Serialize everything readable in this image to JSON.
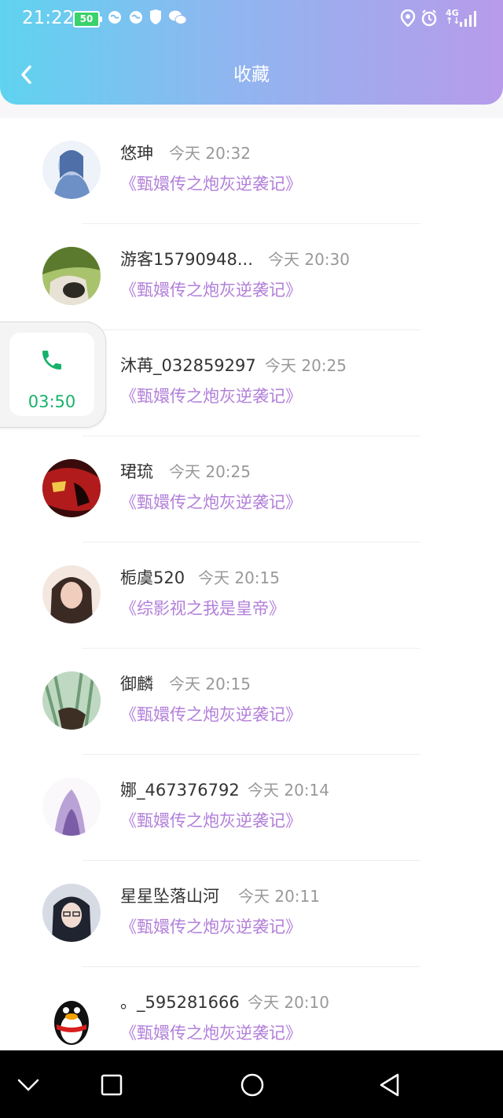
{
  "status_bar": {
    "time": "21:22",
    "battery": "50",
    "network": "4G",
    "network_sub": "↑↓"
  },
  "header": {
    "title": "收藏"
  },
  "items": [
    {
      "name": "悠珅",
      "time": "今天 20:32",
      "book": "《甄嬛传之炮灰逆袭记》",
      "avatar_colors": [
        "#dfe7f3",
        "#5f86bf"
      ]
    },
    {
      "name": "游客15790948...",
      "time": "今天 20:30",
      "book": "《甄嬛传之炮灰逆袭记》",
      "avatar_colors": [
        "#6e8f3c",
        "#2d2a24"
      ]
    },
    {
      "name": "沐苒_032859297",
      "time": "今天 20:25",
      "book": "《甄嬛传之炮灰逆袭记》",
      "avatar_colors": [
        "#d8d0c8",
        "#8c7a6a"
      ]
    },
    {
      "name": "珺琉",
      "time": "今天 20:25",
      "book": "《甄嬛传之炮灰逆袭记》",
      "avatar_colors": [
        "#b21b1b",
        "#2a0808"
      ]
    },
    {
      "name": "栀虞520",
      "time": "今天 20:15",
      "book": "《综影视之我是皇帝》",
      "avatar_colors": [
        "#e8c3b3",
        "#3b2a24"
      ]
    },
    {
      "name": "御麟",
      "time": "今天 20:15",
      "book": "《甄嬛传之炮灰逆袭记》",
      "avatar_colors": [
        "#9cc4a1",
        "#3e6648"
      ]
    },
    {
      "name": "娜_467376792",
      "time": "今天 20:14",
      "book": "《甄嬛传之炮灰逆袭记》",
      "avatar_colors": [
        "#f3eef7",
        "#8d6fb3"
      ]
    },
    {
      "name": "星星坠落山河",
      "time": "今天 20:11",
      "book": "《甄嬛传之炮灰逆袭记》",
      "avatar_colors": [
        "#cdd2dc",
        "#1f2430"
      ]
    },
    {
      "name": "。_595281666",
      "time": "今天 20:10",
      "book": "《甄嬛传之炮灰逆袭记》",
      "avatar_colors": [
        "#ffffff",
        "#111111"
      ]
    }
  ],
  "call_widget": {
    "duration": "03:50",
    "accent": "#17b26a"
  },
  "colors": {
    "accent_book": "#b27fd9",
    "header_start": "#5fd3f0",
    "header_end": "#b79bea"
  }
}
